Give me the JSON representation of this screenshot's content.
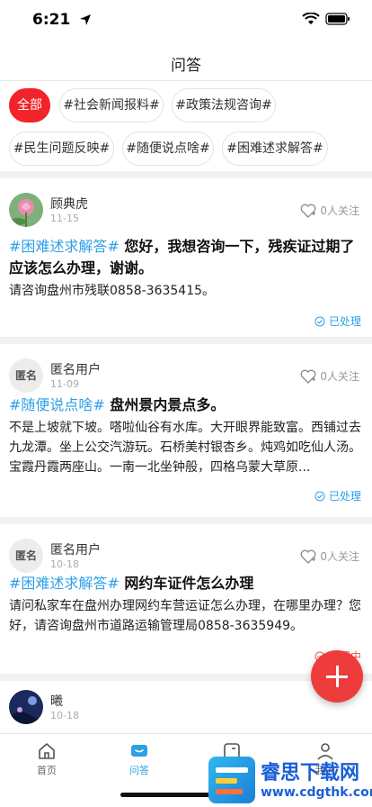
{
  "status_bar": {
    "time": "6:21"
  },
  "nav": {
    "title": "问答"
  },
  "filters": [
    {
      "label": "全部",
      "active": true
    },
    {
      "label": "#社会新闻报料#"
    },
    {
      "label": "#政策法规咨询#"
    },
    {
      "label": "#民生问题反映#"
    },
    {
      "label": "#随便说点啥#"
    },
    {
      "label": "#困难述求解答#"
    }
  ],
  "posts": [
    {
      "user": "顾典虎",
      "date": "11-15",
      "follow": "0人关注",
      "tag": "#困难述求解答#",
      "title": " 您好，我想咨询一下，残疾证过期了应该怎么办理，谢谢。",
      "body": "请咨询盘州市残联0858-3635415。",
      "status": "已处理"
    },
    {
      "user": "匿名用户",
      "avatar_text": "匿名",
      "date": "11-09",
      "follow": "0人关注",
      "tag": "#随便说点啥#",
      "title": " 盘州景内景点多。",
      "body": "不是上坡就下坡。嗒啦仙谷有水库。大开眼界能致富。西铺过去九龙潭。坐上公交汽游玩。石桥美村银杏乡。炖鸡如吃仙人汤。宝霞丹霞两座山。一南一北坐钟般，四格乌蒙大草原...",
      "status": "已处理"
    },
    {
      "user": "匿名用户",
      "avatar_text": "匿名",
      "date": "10-18",
      "follow": "0人关注",
      "tag": "#困难述求解答#",
      "title": " 网约车证件怎么办理",
      "body": "请问私家车在盘州办理网约车营运证怎么办理，在哪里办理？您好，请咨询盘州市道路运输管理局0858-3635949。",
      "status": "处理中"
    },
    {
      "user": "曦",
      "date": "10-18"
    }
  ],
  "tabs": [
    {
      "label": "首页",
      "icon": "home-icon"
    },
    {
      "label": "问答",
      "icon": "chat-icon",
      "active": true
    },
    {
      "label": "",
      "icon": "tablet-icon"
    },
    {
      "label": "我的",
      "icon": "user-icon"
    }
  ],
  "watermark": {
    "title": "睿思下载网",
    "url": "www.cdgthk.com"
  },
  "colors": {
    "accent": "#2ea0e8",
    "active_chip": "#f2232a",
    "pending": "#f05a4a",
    "fab": "#ee3b3b"
  }
}
